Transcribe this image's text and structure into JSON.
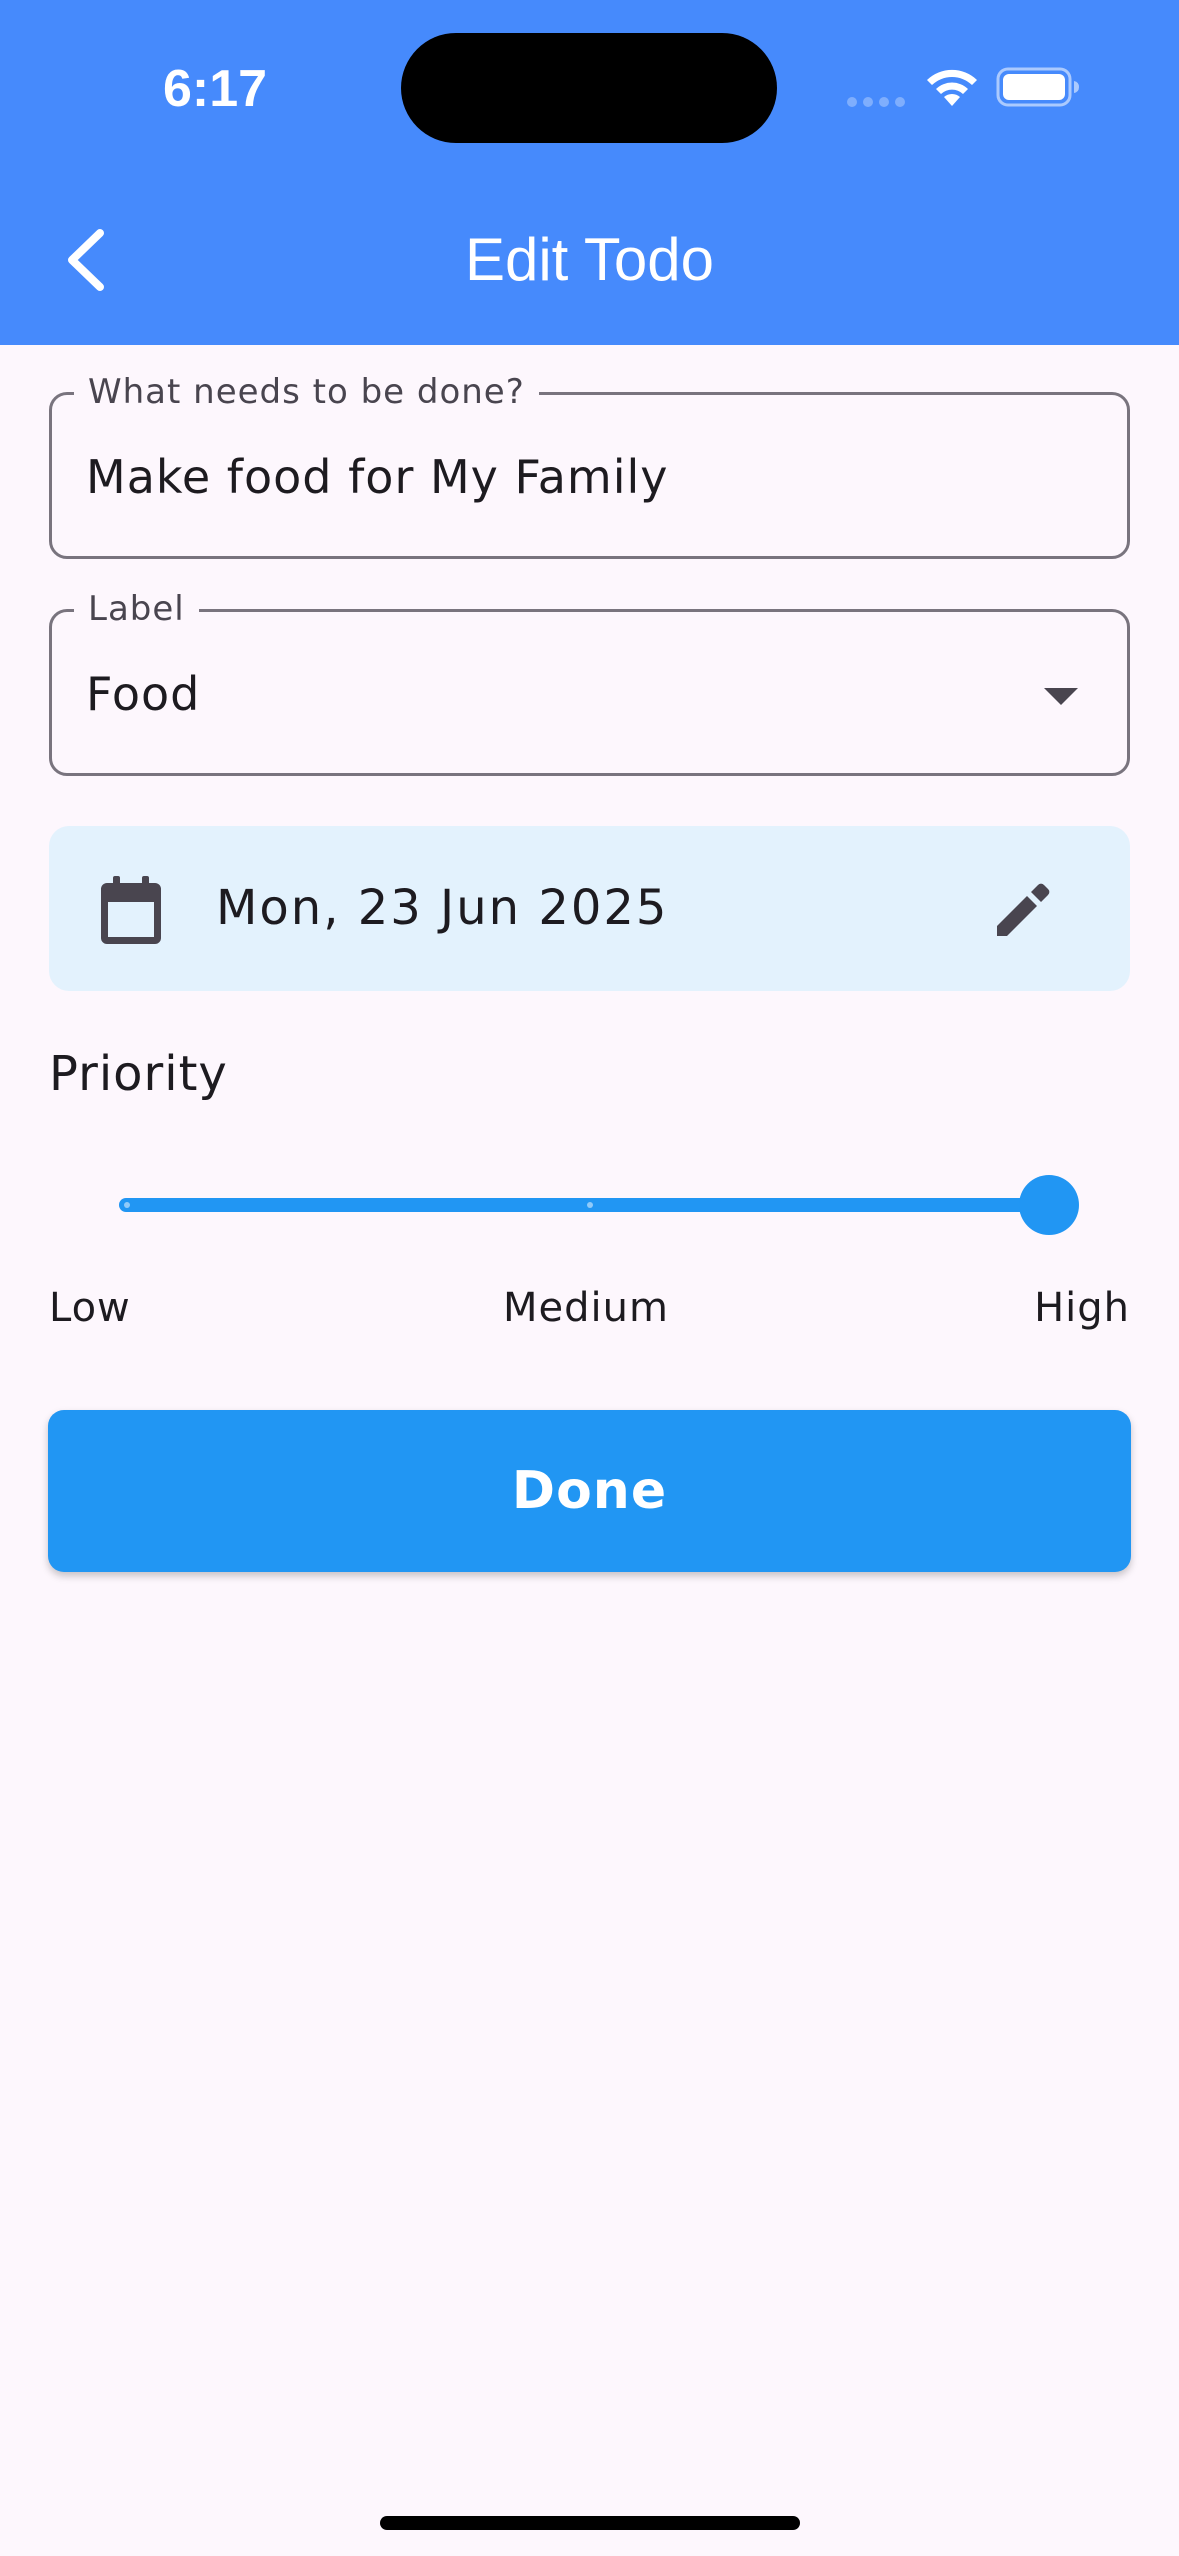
{
  "status_bar": {
    "time": "6:17",
    "icons": [
      "cellular-signal-icon",
      "wifi-icon",
      "battery-icon"
    ]
  },
  "app_bar": {
    "title": "Edit Todo",
    "back_icon": "chevron-left-icon",
    "background_color": "#468AFC"
  },
  "form": {
    "title_field": {
      "label": "What needs to be done?",
      "value": "Make food for My Family"
    },
    "label_field": {
      "label": "Label",
      "selected": "Food",
      "icon": "dropdown-arrow-icon"
    },
    "date_card": {
      "icon": "calendar-icon",
      "date": "Mon, 23 Jun 2025",
      "edit_icon": "pencil-icon",
      "background_color": "#E3F2FD"
    },
    "priority": {
      "heading": "Priority",
      "labels": [
        "Low",
        "Medium",
        "High"
      ],
      "selected_index": 2,
      "value_fraction": 1.0,
      "accent_color": "#2196F3"
    },
    "done_button": {
      "label": "Done",
      "color": "#2196F3"
    }
  }
}
